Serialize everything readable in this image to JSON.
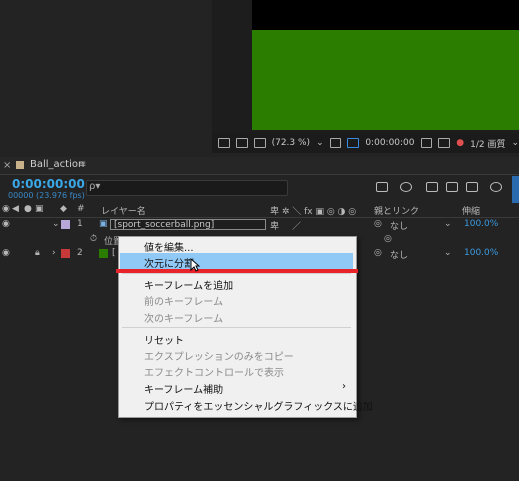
{
  "viewer": {
    "zoom": "(72.3 %)",
    "timecode": "0:00:00:00",
    "resolution": "1/2 画質"
  },
  "timeline": {
    "tab_name": "Ball_action",
    "tab_menu": "≡",
    "tab_close": "×",
    "timecode": "0:00:00:00",
    "fps": "00000 (23.976 fps)",
    "search_glyph": "ρ▾",
    "headers": {
      "num": "#",
      "layer_name": "レイヤー名",
      "parent": "親とリンク",
      "stretch": "伸縮"
    },
    "layers": [
      {
        "index": "1",
        "name": "[sport_soccerball.png]",
        "parent": "なし",
        "stretch": "100.0%",
        "label_color": "#b8a8d8"
      },
      {
        "index": "2",
        "name": "[",
        "parent": "なし",
        "stretch": "100.0%",
        "label_color": "#c83a3a"
      }
    ],
    "sublayer_label": "位置"
  },
  "context_menu": {
    "items": [
      {
        "label": "値を編集...",
        "enabled": true
      },
      {
        "label": "次元に分割",
        "enabled": true,
        "highlighted": true
      },
      {
        "label": "キーフレームを追加",
        "enabled": true
      },
      {
        "label": "前のキーフレーム",
        "enabled": false
      },
      {
        "label": "次のキーフレーム",
        "enabled": false
      },
      {
        "label": "リセット",
        "enabled": true
      },
      {
        "label": "エクスプレッションのみをコピー",
        "enabled": false
      },
      {
        "label": "エフェクトコントロールで表示",
        "enabled": false
      },
      {
        "label": "キーフレーム補助",
        "enabled": true,
        "submenu": true
      },
      {
        "label": "プロパティをエッセンシャルグラフィックスに追加",
        "enabled": true
      }
    ]
  },
  "colors": {
    "accent": "#3aa8e8",
    "highlight": "#90c8f6",
    "underline": "#e8232a",
    "comp_green": "#2b7d00"
  }
}
